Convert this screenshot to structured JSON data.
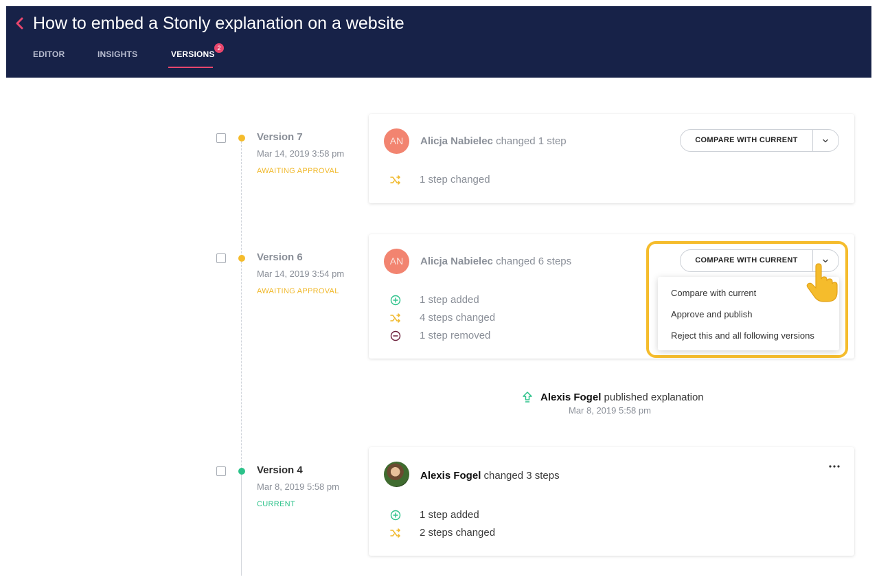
{
  "header": {
    "title": "How to embed a Stonly explanation on a website",
    "tabs": [
      {
        "label": "EDITOR",
        "active": false
      },
      {
        "label": "INSIGHTS",
        "active": false
      },
      {
        "label": "VERSIONS",
        "active": true,
        "badge": "2"
      }
    ],
    "accent_color": "#e8466d",
    "background_color": "#172248"
  },
  "compare_label": "COMPARE WITH CURRENT",
  "versions": [
    {
      "name": "Version 7",
      "date": "Mar 14, 2019 3:58 pm",
      "status": "AWAITING APPROVAL",
      "status_color": "#f0b82a",
      "avatar_initials": "AN",
      "author": "Alicja Nabielec",
      "action": "changed 1 step",
      "changes": [
        {
          "icon": "shuffle-icon",
          "text": "1 step changed"
        }
      ]
    },
    {
      "name": "Version 6",
      "date": "Mar 14, 2019 3:54 pm",
      "status": "AWAITING APPROVAL",
      "status_color": "#f0b82a",
      "avatar_initials": "AN",
      "author": "Alicja Nabielec",
      "action": "changed 6 steps",
      "changes": [
        {
          "icon": "plus-circle-icon",
          "text": "1 step added"
        },
        {
          "icon": "shuffle-icon",
          "text": "4 steps changed"
        },
        {
          "icon": "minus-circle-icon",
          "text": "1 step removed"
        }
      ],
      "dropdown": {
        "items": [
          "Compare with current",
          "Approve and publish",
          "Reject this and all following versions"
        ]
      }
    },
    {
      "name": "Version 4",
      "date": "Mar 8, 2019 5:58 pm",
      "status": "CURRENT",
      "status_color": "#2cc28a",
      "author": "Alexis Fogel",
      "action": "changed 3 steps",
      "changes": [
        {
          "icon": "plus-circle-icon",
          "text": "1 step added"
        },
        {
          "icon": "shuffle-icon",
          "text": "2 steps changed"
        }
      ]
    }
  ],
  "publish_event": {
    "author": "Alexis Fogel",
    "action": "published explanation",
    "date": "Mar 8, 2019 5:58 pm"
  }
}
